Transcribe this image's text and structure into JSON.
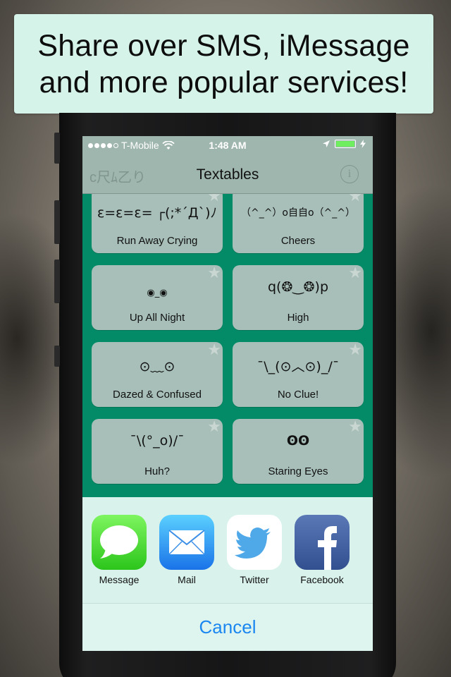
{
  "banner": {
    "line1": "Share over SMS, iMessage",
    "line2": "and more popular services!"
  },
  "status_bar": {
    "carrier": "T-Mobile",
    "time": "1:48 AM",
    "signal_icon": "signal-dots-icon",
    "wifi_icon": "wifi-icon",
    "location_icon": "location-arrow-icon",
    "battery_icon": "battery-charging-icon",
    "battery_color": "#6fef5f"
  },
  "nav": {
    "left_logo": "c尺ﾑ乙り",
    "title": "Textables",
    "info_label": "i"
  },
  "cards": [
    {
      "face": "ε=ε=ε= ┌(;*´Д`)ﾉ",
      "label": "Run Away Crying"
    },
    {
      "face": "（^_^）o自自o（^_^）",
      "label": "Cheers"
    },
    {
      "face": "◉_◉",
      "label": "Up All Night"
    },
    {
      "face": "q(❂‿❂)p",
      "label": "High"
    },
    {
      "face": "⊙﹏⊙",
      "label": "Dazed & Confused"
    },
    {
      "face": "¯\\_(⊙︿⊙)_/¯",
      "label": "No Clue!"
    },
    {
      "face": "¯\\(°_o)/¯",
      "label": "Huh?"
    },
    {
      "face": "ʘʘ",
      "label": "Staring Eyes"
    }
  ],
  "share_sheet": {
    "apps": [
      {
        "name": "Message",
        "icon": "message-bubble-icon"
      },
      {
        "name": "Mail",
        "icon": "mail-envelope-icon"
      },
      {
        "name": "Twitter",
        "icon": "twitter-bird-icon"
      },
      {
        "name": "Facebook",
        "icon": "facebook-f-icon"
      }
    ],
    "cancel_label": "Cancel"
  },
  "colors": {
    "accent_green": "#038a66",
    "banner_bg": "#d6f3ea",
    "cancel_blue": "#1a86f0"
  }
}
